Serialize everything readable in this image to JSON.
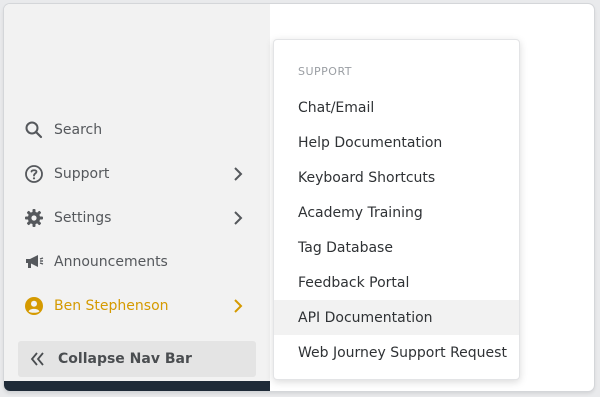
{
  "sidebar": {
    "items": [
      {
        "label": "Search",
        "icon": "search-icon"
      },
      {
        "label": "Support",
        "icon": "help-circle-icon",
        "has_submenu": true
      },
      {
        "label": "Settings",
        "icon": "gear-icon",
        "has_submenu": true
      },
      {
        "label": "Announcements",
        "icon": "megaphone-icon"
      },
      {
        "label": "Ben Stephenson",
        "icon": "user-avatar-icon",
        "has_submenu": true,
        "color": "#d59a00"
      }
    ],
    "collapse_label": "Collapse Nav Bar",
    "collapse_icon": "double-chevron-left-icon"
  },
  "support_menu": {
    "heading": "SUPPORT",
    "items": [
      "Chat/Email",
      "Help Documentation",
      "Keyboard Shortcuts",
      "Academy Training",
      "Tag Database",
      "Feedback Portal",
      "API Documentation",
      "Web Journey Support Request"
    ],
    "highlighted": "API Documentation"
  },
  "colors": {
    "sidebar_bg": "#f2f2f2",
    "accent": "#d59a00",
    "menu_hover": "#f2f2f2",
    "bottom_strip": "#1f2b38"
  }
}
